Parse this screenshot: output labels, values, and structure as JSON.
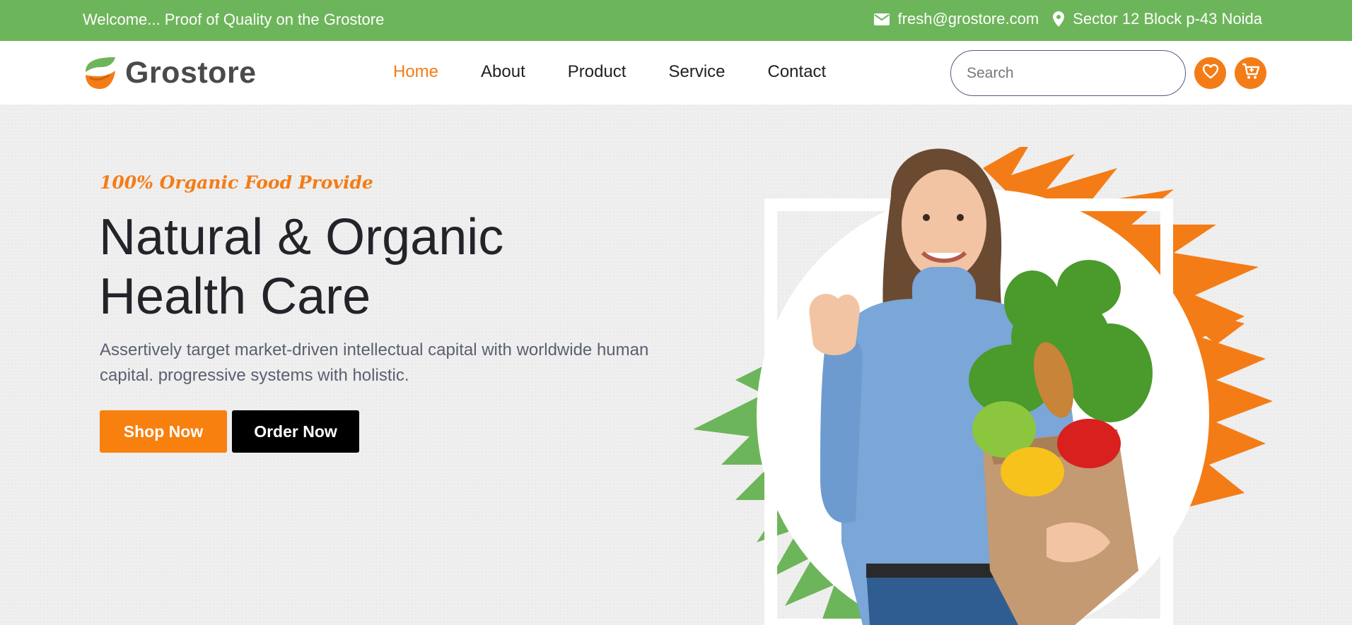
{
  "topbar": {
    "welcome": "Welcome... Proof of Quality on the Grostore",
    "email": "fresh@grostore.com",
    "address": "Sector 12 Block p-43 Noida",
    "email_icon": "envelope-icon",
    "address_icon": "map-pin-icon"
  },
  "header": {
    "logo_text": "Grostore",
    "nav": {
      "home": "Home",
      "about": "About",
      "product": "Product",
      "service": "Service",
      "contact": "Contact"
    },
    "active_nav": "Home",
    "search_placeholder": "Search",
    "wishlist_icon": "heart-icon",
    "cart_icon": "cart-icon"
  },
  "hero": {
    "eyebrow": "100% Organic Food Provide",
    "headline_line1": "Natural & Organic",
    "headline_line2": "Health Care",
    "description": "Assertively target market-driven intellectual capital with worldwide human capital. progressive systems with holistic.",
    "shop_button": "Shop Now",
    "order_button": "Order Now"
  },
  "colors": {
    "brand_green": "#6db55a",
    "brand_orange": "#f47c16",
    "dark_text": "#222429",
    "muted_text": "#5a6070"
  }
}
